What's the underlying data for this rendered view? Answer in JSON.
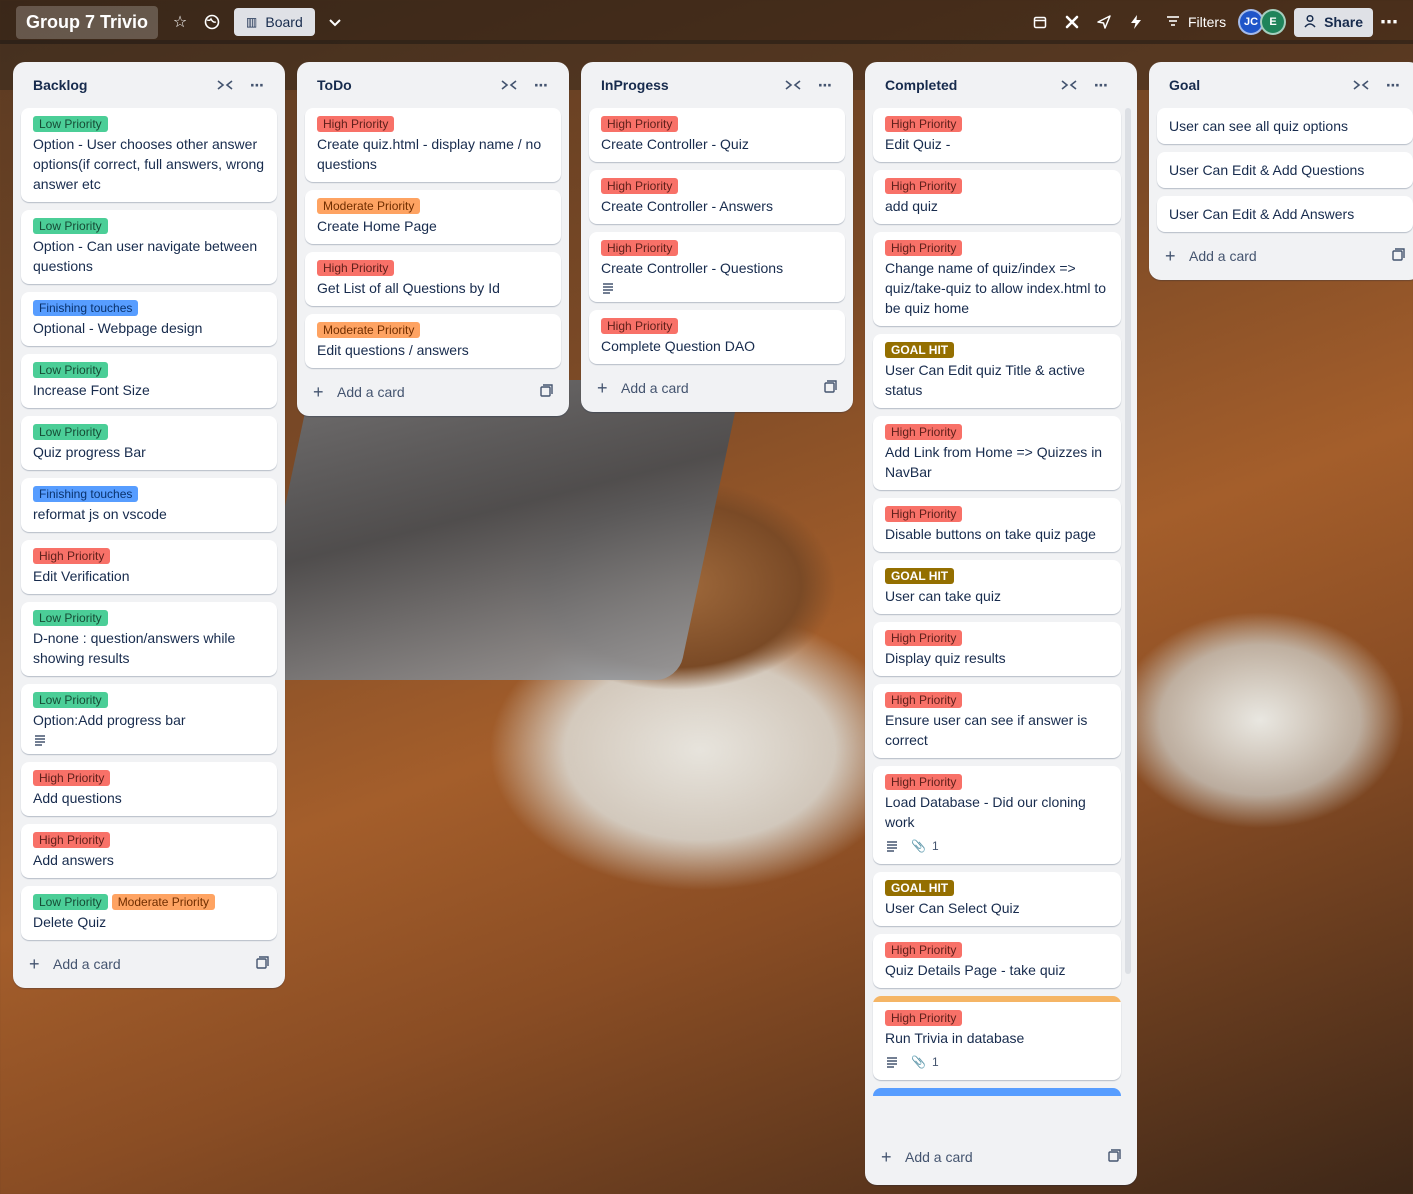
{
  "board": {
    "title": "Group 7 Trivio",
    "view": "Board",
    "filters": "Filters",
    "share": "Share",
    "members": [
      {
        "initials": "JC",
        "color": "#1f55c9"
      },
      {
        "initials": "E",
        "color": "#1f845a"
      }
    ]
  },
  "add_card": "Add a card",
  "lists": [
    {
      "title": "Backlog",
      "cards": [
        {
          "labels": [
            {
              "text": "Low Priority",
              "kind": "low"
            }
          ],
          "title": "Option - User chooses other answer options(if correct, full answers, wrong answer etc"
        },
        {
          "labels": [
            {
              "text": "Low Priority",
              "kind": "low"
            }
          ],
          "title": "Option - Can user navigate between questions"
        },
        {
          "labels": [
            {
              "text": "Finishing touches",
              "kind": "fin"
            }
          ],
          "title": "Optional - Webpage design"
        },
        {
          "labels": [
            {
              "text": "Low Priority",
              "kind": "low"
            }
          ],
          "title": "Increase Font Size"
        },
        {
          "labels": [
            {
              "text": "Low Priority",
              "kind": "low"
            }
          ],
          "title": "Quiz progress Bar"
        },
        {
          "labels": [
            {
              "text": "Finishing touches",
              "kind": "fin"
            }
          ],
          "title": "reformat js on vscode"
        },
        {
          "labels": [
            {
              "text": "High Priority",
              "kind": "high"
            }
          ],
          "title": "Edit Verification"
        },
        {
          "labels": [
            {
              "text": "Low Priority",
              "kind": "low"
            }
          ],
          "title": "D-none : question/answers while showing results"
        },
        {
          "labels": [
            {
              "text": "Low Priority",
              "kind": "low"
            }
          ],
          "title": "Option:Add progress bar",
          "description": true
        },
        {
          "labels": [
            {
              "text": "High Priority",
              "kind": "high"
            }
          ],
          "title": "Add questions"
        },
        {
          "labels": [
            {
              "text": "High Priority",
              "kind": "high"
            }
          ],
          "title": "Add answers"
        },
        {
          "labels": [
            {
              "text": "Low Priority",
              "kind": "low"
            },
            {
              "text": "Moderate Priority",
              "kind": "mod"
            }
          ],
          "title": "Delete Quiz"
        }
      ]
    },
    {
      "title": "ToDo",
      "cards": [
        {
          "labels": [
            {
              "text": "High Priority",
              "kind": "high"
            }
          ],
          "title": "Create quiz.html - display name / no questions"
        },
        {
          "labels": [
            {
              "text": "Moderate Priority",
              "kind": "mod"
            }
          ],
          "title": "Create Home Page"
        },
        {
          "labels": [
            {
              "text": "High Priority",
              "kind": "high"
            }
          ],
          "title": "Get List of all Questions by Id"
        },
        {
          "labels": [
            {
              "text": "Moderate Priority",
              "kind": "mod"
            }
          ],
          "title": "Edit questions / answers"
        }
      ]
    },
    {
      "title": "InProgess",
      "cards": [
        {
          "labels": [
            {
              "text": "High Priority",
              "kind": "high"
            }
          ],
          "title": "Create Controller - Quiz"
        },
        {
          "labels": [
            {
              "text": "High Priority",
              "kind": "high"
            }
          ],
          "title": "Create Controller - Answers"
        },
        {
          "labels": [
            {
              "text": "High Priority",
              "kind": "high"
            }
          ],
          "title": "Create Controller - Questions",
          "description": true
        },
        {
          "labels": [
            {
              "text": "High Priority",
              "kind": "high"
            }
          ],
          "title": "Complete Question DAO"
        }
      ]
    },
    {
      "title": "Completed",
      "cards": [
        {
          "labels": [
            {
              "text": "High Priority",
              "kind": "high"
            }
          ],
          "title": "Edit Quiz -"
        },
        {
          "labels": [
            {
              "text": "High Priority",
              "kind": "high"
            }
          ],
          "title": "add quiz"
        },
        {
          "labels": [
            {
              "text": "High Priority",
              "kind": "high"
            }
          ],
          "title": "Change name of quiz/index => quiz/take-quiz to allow index.html to be quiz home"
        },
        {
          "labels": [
            {
              "text": "GOAL HIT",
              "kind": "goal"
            }
          ],
          "title": "User Can Edit quiz Title & active status"
        },
        {
          "labels": [
            {
              "text": "High Priority",
              "kind": "high"
            }
          ],
          "title": "Add Link from Home => Quizzes in NavBar"
        },
        {
          "labels": [
            {
              "text": "High Priority",
              "kind": "high"
            }
          ],
          "title": "Disable buttons on take quiz page"
        },
        {
          "labels": [
            {
              "text": "GOAL HIT",
              "kind": "goal"
            }
          ],
          "title": "User can take quiz"
        },
        {
          "labels": [
            {
              "text": "High Priority",
              "kind": "high"
            }
          ],
          "title": "Display quiz results"
        },
        {
          "labels": [
            {
              "text": "High Priority",
              "kind": "high"
            }
          ],
          "title": "Ensure user can see if answer is correct"
        },
        {
          "labels": [
            {
              "text": "High Priority",
              "kind": "high"
            }
          ],
          "title": "Load Database - Did our cloning work",
          "description": true,
          "attachments": "1"
        },
        {
          "labels": [
            {
              "text": "GOAL HIT",
              "kind": "goal"
            }
          ],
          "title": "User Can Select Quiz"
        },
        {
          "labels": [
            {
              "text": "High Priority",
              "kind": "high"
            }
          ],
          "title": "Quiz Details Page - take quiz"
        },
        {
          "cover": "#f5b565",
          "labels": [
            {
              "text": "High Priority",
              "kind": "high"
            }
          ],
          "title": "Run Trivia in database",
          "description": true,
          "attachments": "1"
        }
      ]
    },
    {
      "title": "Goal",
      "cards": [
        {
          "labels": [],
          "title": "User can see all quiz options"
        },
        {
          "labels": [],
          "title": "User Can Edit & Add Questions"
        },
        {
          "labels": [],
          "title": "User Can Edit & Add Answers"
        }
      ]
    }
  ]
}
